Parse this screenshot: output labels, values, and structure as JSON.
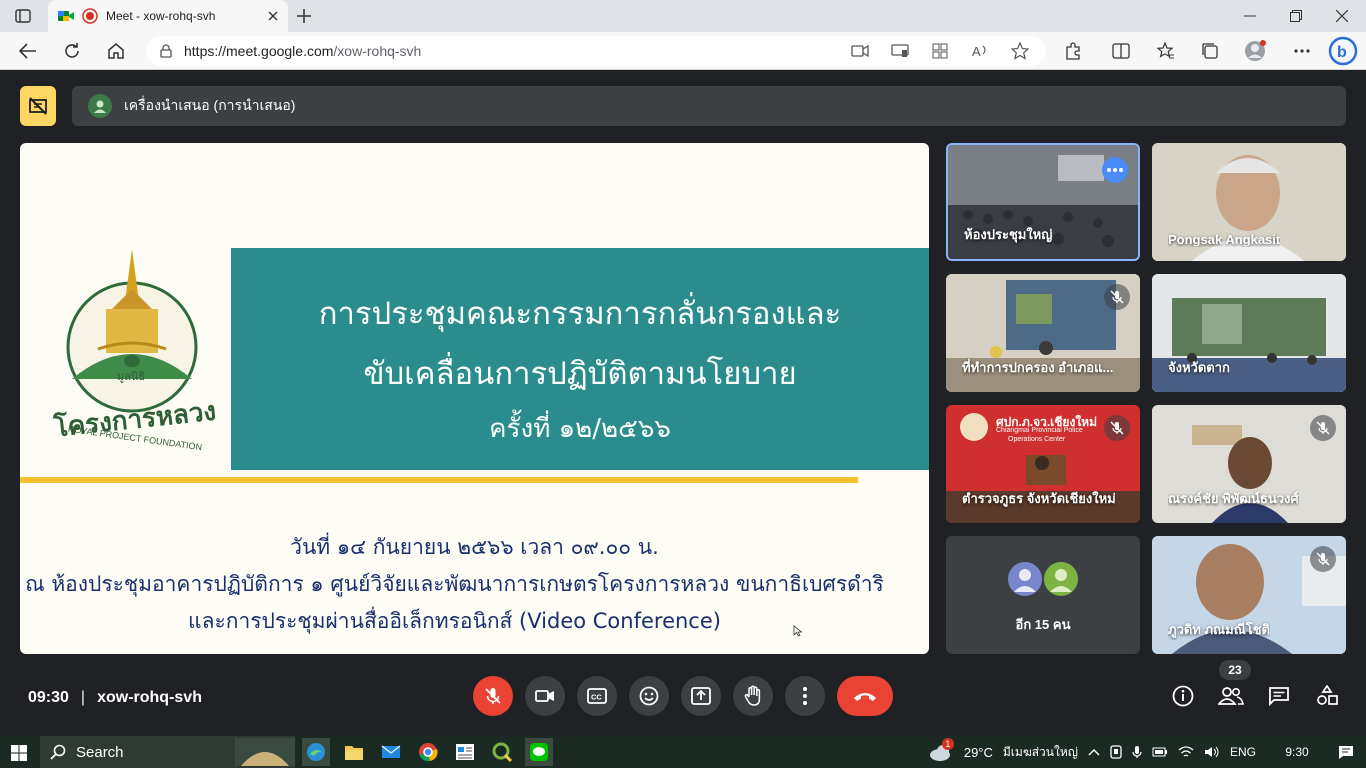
{
  "browser": {
    "tab_title": "Meet - xow-rohq-svh",
    "url_host": "https://meet.google.com",
    "url_path": "/xow-rohq-svh"
  },
  "meet": {
    "presenter_label": "เครื่องนำเสนอ (การนำเสนอ)",
    "meeting_time": "09:30",
    "separator": "|",
    "meeting_code": "xow-rohq-svh",
    "participant_count": "23"
  },
  "slide": {
    "title_line1": "การประชุมคณะกรรมการกลั่นกรองและ",
    "title_line2": "ขับเคลื่อนการปฏิบัติตามนโยบาย",
    "title_line3": "ครั้งที่ ๑๒/๒๕๖๖",
    "date_line": "วันที่ ๑๔ กันยายน ๒๕๖๖ เวลา ๐๙.๐๐ น.",
    "location_line": "ณ ห้องประชุมอาคารปฏิบัติการ ๑ ศูนย์วิจัยและพัฒนาการเกษตรโครงการหลวง ขนกาธิเบศรดำริ",
    "conference_line": "และการประชุมผ่านสื่ออิเล็กทรอนิกส์ (Video Conference)",
    "logo_text_top": "มูลนิธิ",
    "logo_text_mid": "โครงการหลวง",
    "logo_text_en": "ROYAL PROJECT FOUNDATION"
  },
  "participants": [
    {
      "name": "ห้องประชุมใหญ่",
      "muted": false
    },
    {
      "name": "Pongsak Angkasit",
      "muted": false
    },
    {
      "name": "ที่ทำการปกครอง อำเภอแ...",
      "muted": true
    },
    {
      "name": "จังหวัดตาก",
      "muted": false
    },
    {
      "name": "ตำรวจภูธร จังหวัดเชียงใหม่",
      "muted": true
    },
    {
      "name": "ณรงค์ชัย พิพัฒน์ธนวงศ์",
      "muted": true
    },
    {
      "name": "อีก 15 คน",
      "muted": false
    },
    {
      "name": "ภูวดิท ภณมณีโชติ",
      "muted": true
    }
  ],
  "tile_texts": {
    "police_sign_th": "ศปก.ภ.จว.เชียงใหม่",
    "police_sign_en1": "Chiangmai Provincial Police",
    "police_sign_en2": "Operations Center"
  },
  "taskbar": {
    "search_label": "Search",
    "weather_temp": "29°C",
    "weather_desc": "มีเมฆส่วนใหญ่",
    "language": "ENG",
    "time": "9:30",
    "weather_badge": "1"
  },
  "colors": {
    "meet_bg": "#202124",
    "tile_bg": "#3c4043",
    "end_call": "#ea4335",
    "slide_teal": "#2a8c8c",
    "slide_gold": "#f2c232",
    "slide_text": "#1a2f6e"
  }
}
